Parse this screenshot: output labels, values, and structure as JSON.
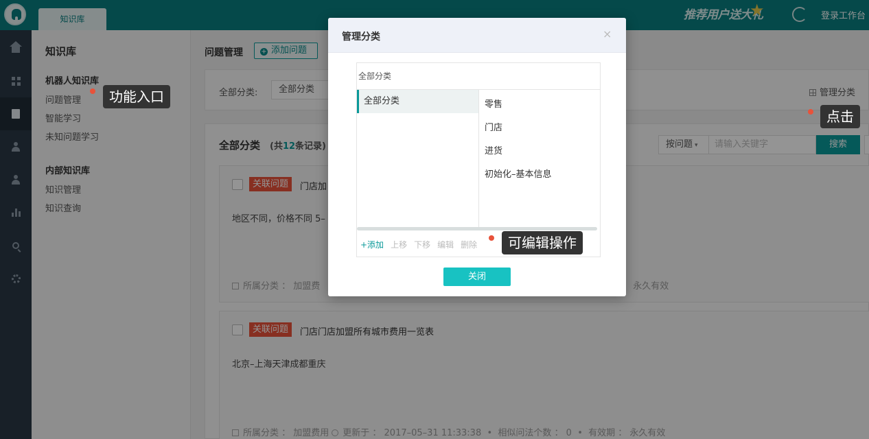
{
  "topbar": {
    "tab_label": "知识库",
    "promo_text": "推荐用户送大礼",
    "login_label": "登录工作台"
  },
  "sidebar": {
    "title": "知识库",
    "group_robot": "机器人知识库",
    "robot_items": [
      "问题管理",
      "智能学习",
      "未知问题学习"
    ],
    "group_internal": "内部知识库",
    "internal_items": [
      "知识管理",
      "知识查询"
    ]
  },
  "main": {
    "page_title": "问题管理",
    "add_button": "添加问题",
    "filter_label": "全部分类:",
    "filter_value": "全部分类",
    "manage_category": "管理分类",
    "list_title": "全部分类",
    "count_prefix": "(共",
    "count_value": "12",
    "count_suffix": "条记录)",
    "search_mode": "按问题",
    "search_placeholder": "请输入关键字",
    "search_button": "搜索",
    "cards": [
      {
        "tag": "关联问题",
        "question": "门店加",
        "answer": "地区不同，价格不同 5–",
        "meta": "所属分类 ： 加盟费",
        "meta_tail": "期 ： 永久有效"
      },
      {
        "tag": "关联问题",
        "question": "门店门店加盟所有城市费用一览表",
        "answer": "北京–上海天津成都重庆",
        "meta_category": "所属分类 ： 加盟费用",
        "meta_updated": "更新于 ： 2017–05–31 11:33:38  •  相似问法个数 ： 0  •  有效期 ： 永久有效"
      }
    ]
  },
  "modal": {
    "title": "管理分类",
    "close_glyph": "×",
    "tree_header": "全部分类",
    "left_item": "全部分类",
    "right_items": [
      "零售",
      "门店",
      "进货",
      "初始化–基本信息"
    ],
    "actions": [
      "+添加",
      "上移",
      "下移",
      "编辑",
      "删除"
    ],
    "close_button": "关闭"
  },
  "annotations": {
    "entry": "功能入口",
    "click": "点击",
    "editable": "可编辑操作",
    "dot_color": "#e8523a"
  },
  "colors": {
    "brand": "#0a7f80",
    "accent": "#0a9999",
    "tag_red": "#e8523a"
  }
}
